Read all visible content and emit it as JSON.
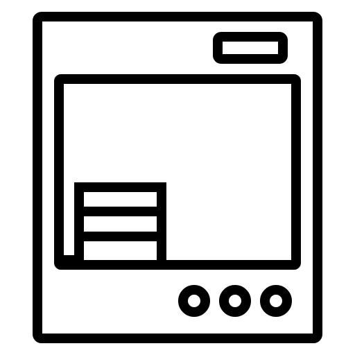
{
  "icon": {
    "name": "appliance-with-screen-icon",
    "stroke_color": "#000000",
    "background_color": "#ffffff"
  },
  "parts": {
    "frame": "device-body",
    "display_slot": "top-slot",
    "screen": "main-screen",
    "stacked_blocks": "stacked-blocks",
    "buttons": [
      "button-1",
      "button-2",
      "button-3"
    ]
  }
}
